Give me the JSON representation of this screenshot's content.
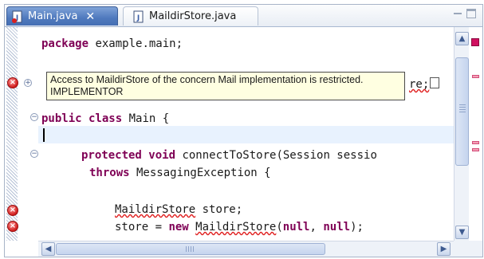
{
  "tabs": [
    {
      "label": "Main.java",
      "active": true,
      "icon": "java-file-icon",
      "close": "✕"
    },
    {
      "label": "MaildirStore.java",
      "active": false,
      "icon": "java-file-icon"
    }
  ],
  "editor": {
    "lines": {
      "package_kw": "package",
      "package_name": " example.main;",
      "import_tail": "re;",
      "class_decl": "public class",
      "class_name": " Main {",
      "method_mod": "protected void",
      "method_sig": " connectToStore(Session sessio",
      "throws_kw": "throws",
      "throws_type": " MessagingException {",
      "store_type": "MaildirStore",
      "store_var": " store;",
      "assign_lhs": "store = ",
      "new_kw": "new",
      "new_type": "MaildirStore",
      "args_open": "(",
      "null1": "null",
      "comma": ", ",
      "null2": "null",
      "args_close": ");"
    }
  },
  "tooltip": {
    "message": "Access to MaildirStore of the concern Mail implementation is restricted.",
    "role": "IMPLEMENTOR"
  },
  "colors": {
    "keyword": "#7f0055",
    "error": "#e02020",
    "tooltip_bg": "#ffffe1",
    "active_tab": "#4f79bd"
  }
}
